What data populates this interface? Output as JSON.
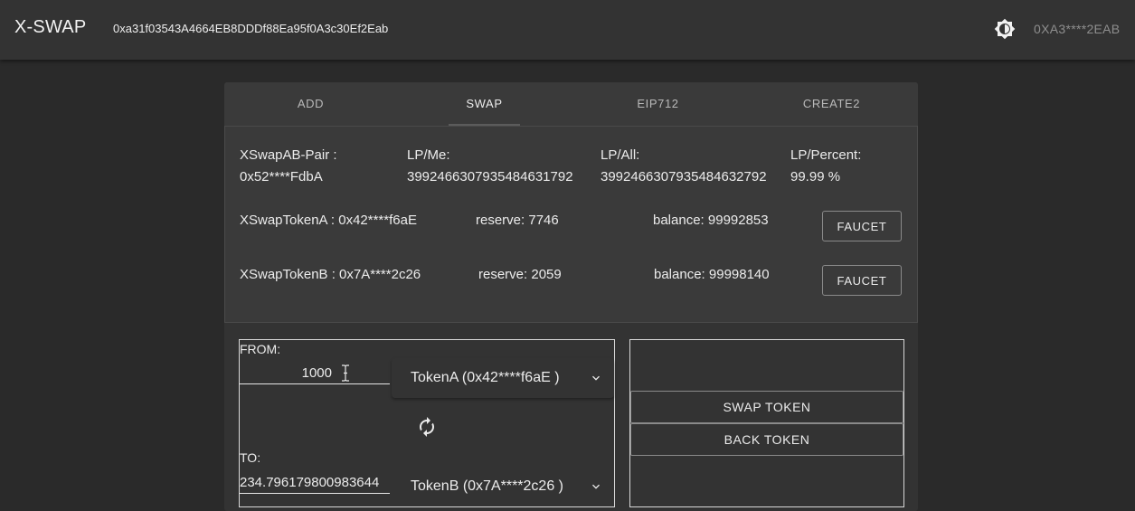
{
  "header": {
    "brand": "X-SWAP",
    "contract_address": "0xa31f03543A4664EB8DDDf88Ea95f0A3c30Ef2Eab",
    "theme_icon": "brightness-icon",
    "account": "0XA3****2EAB"
  },
  "tabs": [
    {
      "label": "ADD",
      "active": false
    },
    {
      "label": "SWAP",
      "active": true
    },
    {
      "label": "EIP712",
      "active": false
    },
    {
      "label": "CREATE2",
      "active": false
    }
  ],
  "pair": {
    "label": "XSwapAB-Pair :",
    "address": "0x52****FdbA",
    "lp_me_label": "LP/Me:",
    "lp_me_value": "3992466307935484631792",
    "lp_all_label": "LP/All:",
    "lp_all_value": "3992466307935484632792",
    "lp_percent_label": "LP/Percent:",
    "lp_percent_value": "99.99 %"
  },
  "tokens": [
    {
      "name": "XSwapTokenA : 0x42****f6aE",
      "reserve": "reserve: 7746",
      "balance": "balance: 99992853",
      "faucet_label": "FAUCET"
    },
    {
      "name": "XSwapTokenB : 0x7A****2c26",
      "reserve": "reserve: 2059",
      "balance": "balance: 99998140",
      "faucet_label": "FAUCET"
    }
  ],
  "swap": {
    "from_label": "FROM:",
    "from_value": "1000",
    "from_token": "TokenA (0x42****f6aE )",
    "to_label": "TO:",
    "to_value": "234.796179800983644",
    "to_token": "TokenB (0x7A****2c26 )",
    "swap_icon": "swap-direction-icon",
    "swap_button": "SWAP TOKEN",
    "back_button": "BACK TOKEN"
  },
  "colors": {
    "background": "#2a2a2a",
    "appbar": "#333333",
    "card": "#3a3a3a",
    "text": "#ececec",
    "muted": "#8e8e8e"
  }
}
